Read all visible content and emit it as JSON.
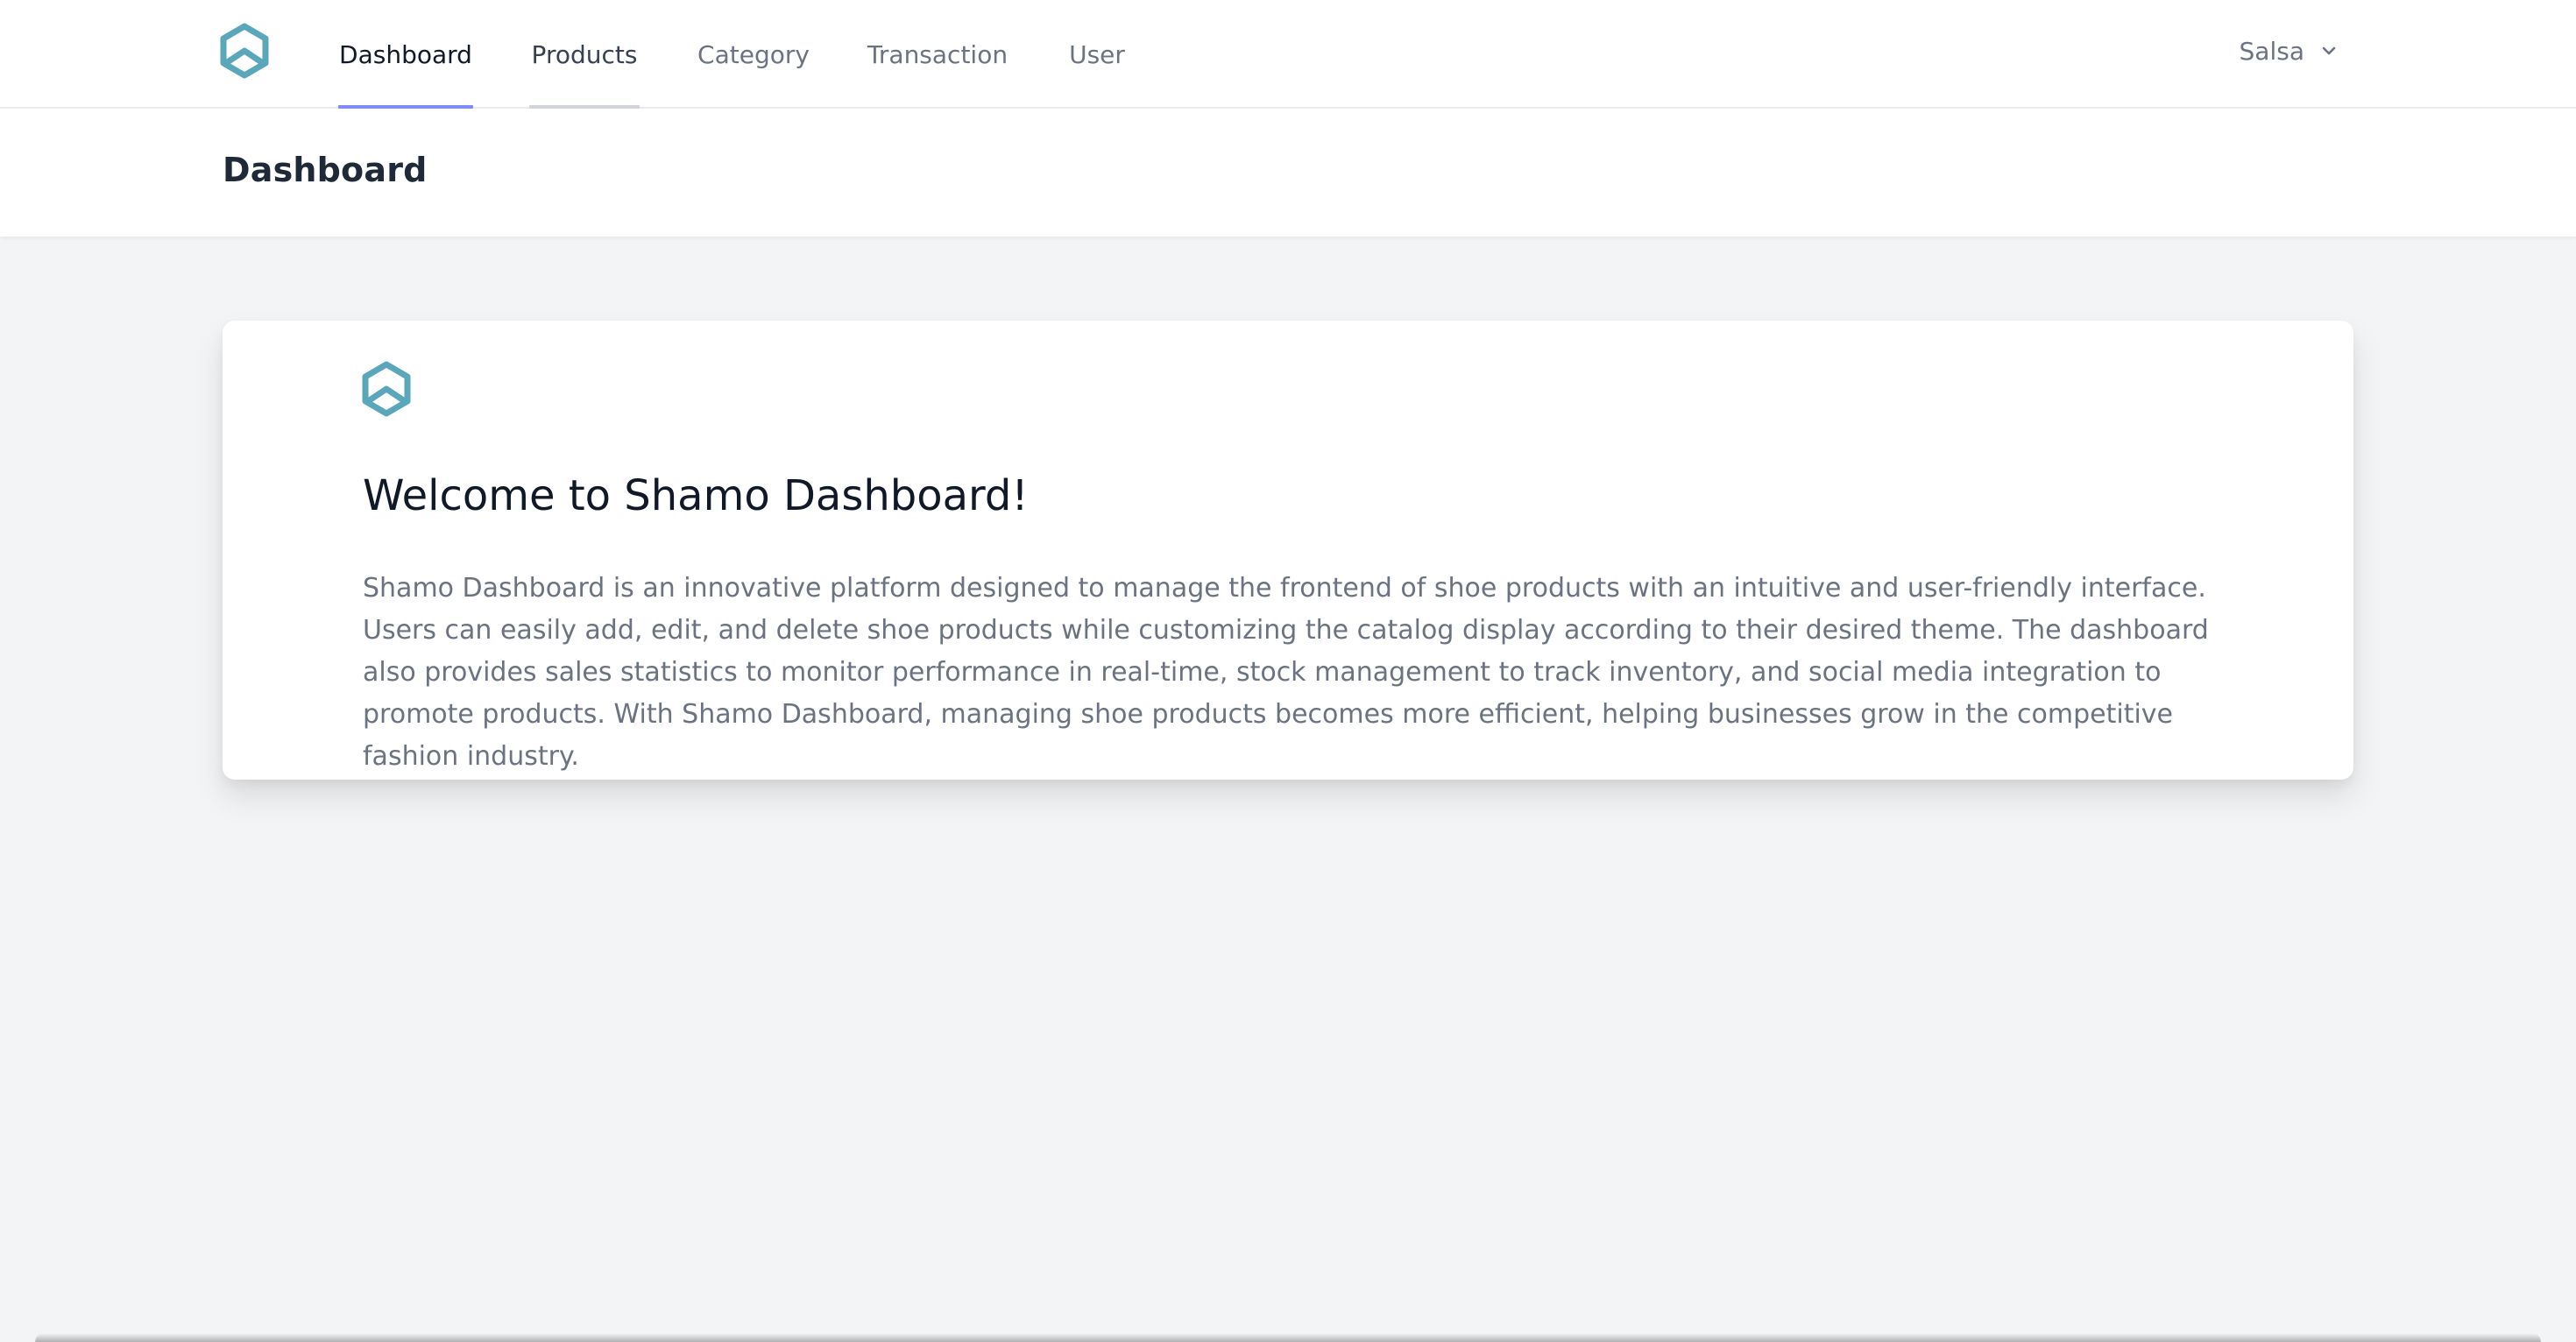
{
  "app": {
    "logo_icon": "hexagon-logo-icon",
    "brand_color": "#5aa7bb",
    "accent_color": "#818cf8"
  },
  "nav": {
    "items": [
      {
        "label": "Dashboard",
        "state": "active"
      },
      {
        "label": "Products",
        "state": "hover"
      },
      {
        "label": "Category",
        "state": "default"
      },
      {
        "label": "Transaction",
        "state": "default"
      },
      {
        "label": "User",
        "state": "default"
      }
    ]
  },
  "user_menu": {
    "name": "Salsa",
    "icon": "chevron-down-icon"
  },
  "header": {
    "title": "Dashboard"
  },
  "welcome": {
    "icon": "hexagon-logo-icon",
    "title": "Welcome to Shamo Dashboard!",
    "description": "Shamo Dashboard is an innovative platform designed to manage the frontend of shoe products with an intuitive and user-friendly interface. Users can easily add, edit, and delete shoe products while customizing the catalog display according to their desired theme. The dashboard also provides sales statistics to monitor performance in real-time, stock management to track inventory, and social media integration to promote products. With Shamo Dashboard, managing shoe products becomes more efficient, helping businesses grow in the competitive fashion industry."
  }
}
